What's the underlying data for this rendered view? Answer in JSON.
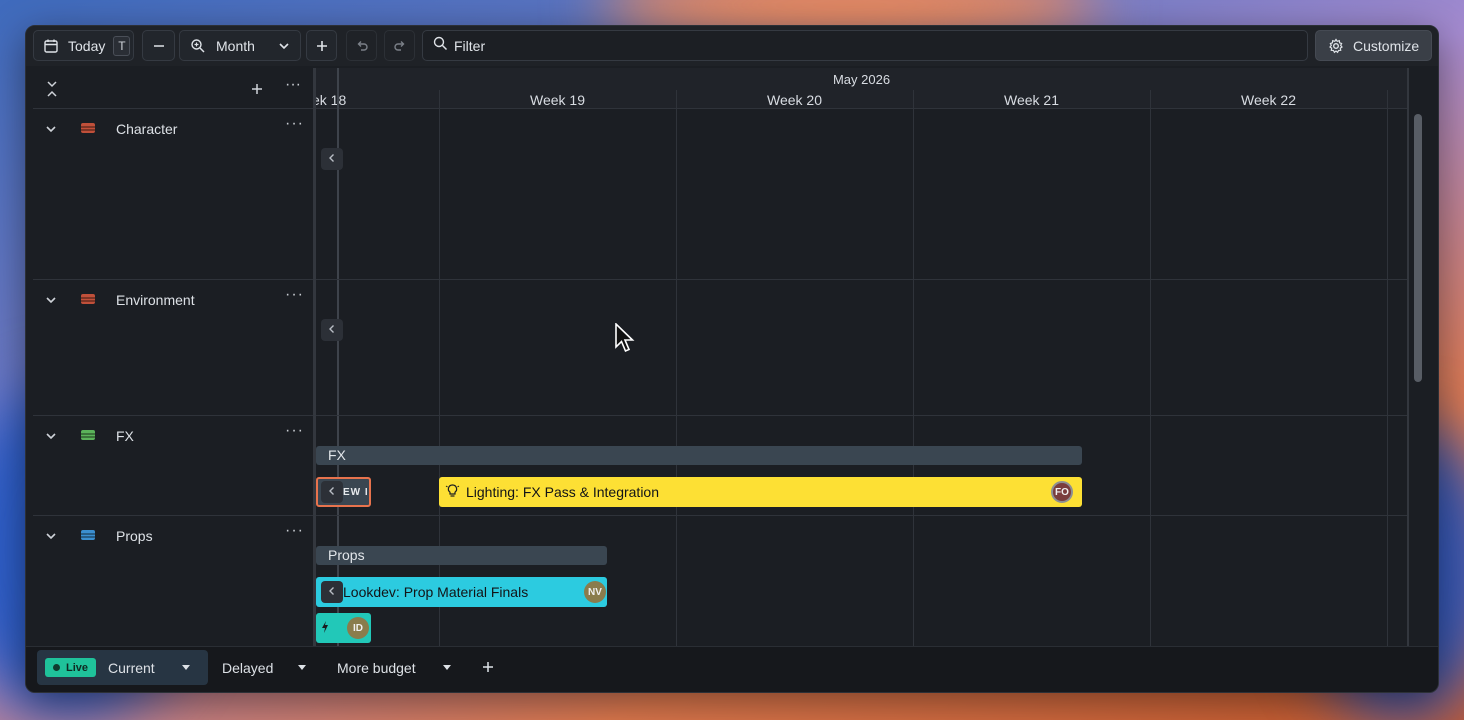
{
  "toolbar": {
    "today_label": "Today",
    "today_shortcut": "T",
    "zoom_label": "Month",
    "filter_placeholder": "Filter",
    "customize_label": "Customize"
  },
  "timeline": {
    "month": "May 2026",
    "weeks": [
      "ek 18",
      "Week 19",
      "Week 20",
      "Week 21",
      "Week 22"
    ]
  },
  "groups": [
    {
      "name": "Character",
      "color": "#c0503a"
    },
    {
      "name": "Environment",
      "color": "#c0503a"
    },
    {
      "name": "FX",
      "color": "#5bb35a"
    },
    {
      "name": "Props",
      "color": "#3b8fd0"
    }
  ],
  "bars": {
    "fx_group_label": "FX",
    "fx_small_label": "EW I",
    "fx_task_label": "Lighting: FX Pass & Integration",
    "fx_task_color": "#fde034",
    "fx_task_avatar": "FO",
    "props_group_label": "Props",
    "props_task_label": "Lookdev: Prop Material Finals",
    "props_task_color": "#2ccbe0",
    "props_task_avatar": "NV",
    "props_small_avatar": "ID",
    "props_small_color": "#22c8b8"
  },
  "bottom": {
    "live_label": "Live",
    "views": [
      "Current",
      "Delayed",
      "More budget"
    ]
  }
}
